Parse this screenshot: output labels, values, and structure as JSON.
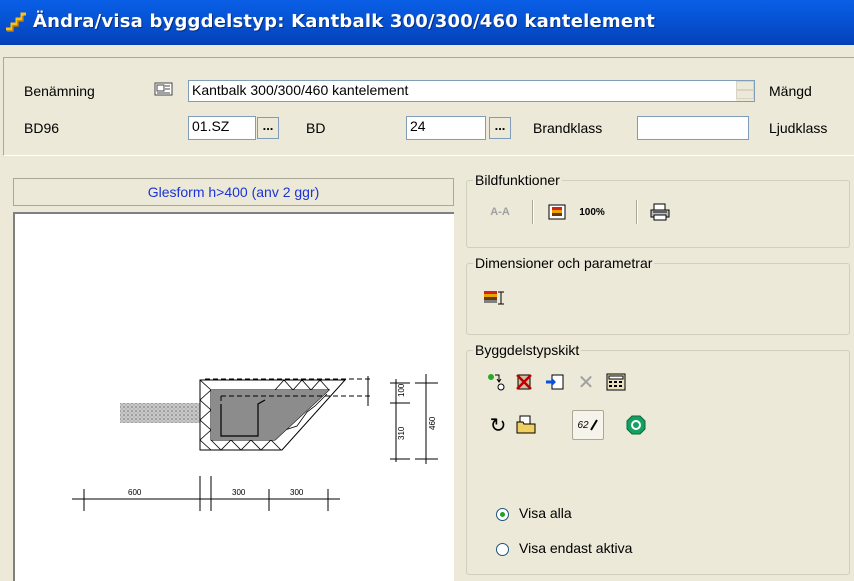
{
  "window": {
    "title": "Ändra/visa byggdelstyp: Kantbalk 300/300/460 kantelement",
    "icon": "stairs-icon"
  },
  "form": {
    "benamning_label": "Benämning",
    "benamning_value": "Kantbalk 300/300/460 kantelement",
    "mangd_label": "Mängd",
    "bd96_label": "BD96",
    "bd96_value": "01.SZ",
    "bd_label": "BD",
    "bd_value": "24",
    "brandklass_label": "Brandklass",
    "brandklass_value": "",
    "ljudklass_label": "Ljudklass",
    "browse_label": "..."
  },
  "left": {
    "header": "Glesform h>400 (anv 2 ggr)",
    "drawing": {
      "dims_bottom": [
        "600",
        "300",
        "300"
      ],
      "dim_small": "100",
      "dim_mid": "310",
      "dim_total": "460"
    }
  },
  "bildfunktioner": {
    "title": "Bildfunktioner",
    "section_label": "A-A",
    "zoom_label": "100%"
  },
  "dimensioner": {
    "title": "Dimensioner och parametrar"
  },
  "skikt": {
    "title": "Byggdelstypskikt",
    "edit_label": "62",
    "radio_all": "Visa alla",
    "radio_active": "Visa endast aktiva",
    "selected": "all"
  },
  "colors": {
    "title_bar": "#0454d8",
    "face": "#ece9d8",
    "header_text": "#1a34d6"
  }
}
